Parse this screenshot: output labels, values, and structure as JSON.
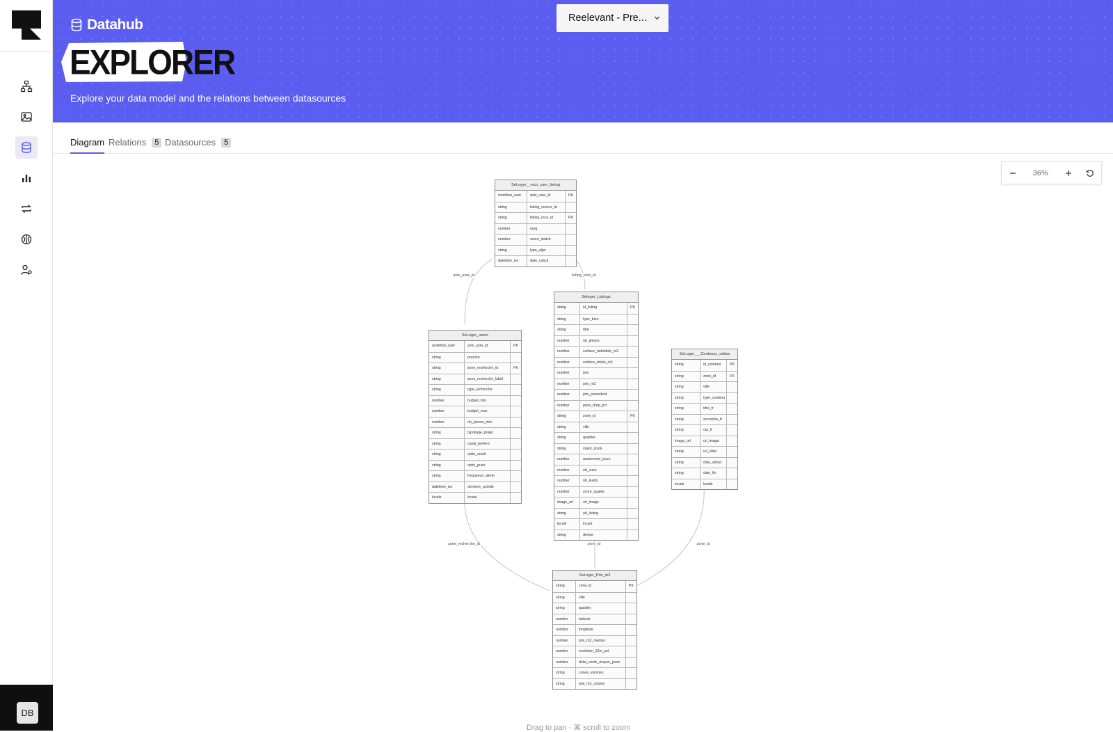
{
  "app": {
    "brand_label": "Datahub",
    "page_title": "EXPLORER",
    "subtitle": "Explore your data model and the relations between datasources",
    "project_selector": "Reelevant - Pre...",
    "avatar_initials": "DB",
    "accent_color": "#5b5cf0"
  },
  "sidebar": {
    "items": [
      {
        "icon": "workflow-icon",
        "active": false
      },
      {
        "icon": "image-gallery-icon",
        "active": false
      },
      {
        "icon": "database-icon",
        "active": true
      },
      {
        "icon": "bar-chart-icon",
        "active": false
      },
      {
        "icon": "sync-icon",
        "active": false
      },
      {
        "icon": "brain-icon",
        "active": false
      },
      {
        "icon": "users-settings-icon",
        "active": false
      }
    ]
  },
  "tabs": [
    {
      "label": "Diagram",
      "count": null
    },
    {
      "label": "Relations",
      "count": "5"
    },
    {
      "label": "Datasources",
      "count": "5"
    }
  ],
  "zoom": {
    "value": "36%"
  },
  "hint": "Drag to pan · ⌘ scroll to zoom",
  "tables": [
    {
      "name": "SeLoger__reco_user_listing",
      "rows": [
        [
          "workflow_user",
          "avtv_user_id",
          "PK"
        ],
        [
          "string",
          "listing_source_id",
          ""
        ],
        [
          "string",
          "listing_reco_id",
          "PK"
        ],
        [
          "number",
          "rang",
          ""
        ],
        [
          "number",
          "score_match",
          ""
        ],
        [
          "string",
          "type_algo",
          ""
        ],
        [
          "datetime_iso",
          "date_calcul",
          ""
        ]
      ]
    },
    {
      "name": "Seloger_Listings",
      "rows": [
        [
          "string",
          "id_listing",
          "PK"
        ],
        [
          "string",
          "type_bien",
          ""
        ],
        [
          "string",
          "titre",
          ""
        ],
        [
          "number",
          "nb_pieces",
          ""
        ],
        [
          "number",
          "surface_habitable_m2",
          ""
        ],
        [
          "number",
          "surface_totale_m2",
          ""
        ],
        [
          "number",
          "prix",
          ""
        ],
        [
          "number",
          "prix_m2",
          ""
        ],
        [
          "number",
          "prix_precedent",
          ""
        ],
        [
          "number",
          "price_drop_pct",
          ""
        ],
        [
          "string",
          "zone_id",
          "FK"
        ],
        [
          "string",
          "ville",
          ""
        ],
        [
          "string",
          "quartier",
          ""
        ],
        [
          "string",
          "statut_stock",
          ""
        ],
        [
          "number",
          "anciennete_jours",
          ""
        ],
        [
          "number",
          "nb_vues",
          ""
        ],
        [
          "number",
          "nb_leads",
          ""
        ],
        [
          "number",
          "score_qualite",
          ""
        ],
        [
          "image_url",
          "url_image",
          ""
        ],
        [
          "string",
          "url_listing",
          ""
        ],
        [
          "locale",
          "locale",
          ""
        ],
        [
          "string",
          "devise",
          ""
        ]
      ]
    },
    {
      "name": "SeLoger_users",
      "rows": [
        [
          "workflow_user",
          "avtv_user_id",
          "PK"
        ],
        [
          "string",
          "prenom",
          ""
        ],
        [
          "string",
          "zone_recherche_id",
          "FK"
        ],
        [
          "string",
          "zone_recherche_label",
          ""
        ],
        [
          "string",
          "type_recherche",
          ""
        ],
        [
          "number",
          "budget_min",
          ""
        ],
        [
          "number",
          "budget_max",
          ""
        ],
        [
          "number",
          "nb_pieces_min",
          ""
        ],
        [
          "string",
          "typologie_projet",
          ""
        ],
        [
          "string",
          "canal_prefere",
          ""
        ],
        [
          "string",
          "optin_email",
          ""
        ],
        [
          "string",
          "optin_push",
          ""
        ],
        [
          "string",
          "frequence_alerte",
          ""
        ],
        [
          "datetime_iso",
          "derniere_activite",
          ""
        ],
        [
          "locale",
          "locale",
          ""
        ]
      ]
    },
    {
      "name": "SeLoger___Contenus_editos",
      "rows": [
        [
          "string",
          "id_contenu",
          "PK"
        ],
        [
          "string",
          "zone_id",
          "FK"
        ],
        [
          "string",
          "ville",
          ""
        ],
        [
          "string",
          "type_contenu",
          ""
        ],
        [
          "string",
          "titre_fr",
          ""
        ],
        [
          "string",
          "accroche_fr",
          ""
        ],
        [
          "string",
          "cta_fr",
          ""
        ],
        [
          "image_url",
          "url_image",
          ""
        ],
        [
          "string",
          "url_cible",
          ""
        ],
        [
          "string",
          "date_debut",
          ""
        ],
        [
          "string",
          "date_fin",
          ""
        ],
        [
          "locale",
          "locale",
          ""
        ]
      ]
    },
    {
      "name": "SeLoger_Prix_m2",
      "rows": [
        [
          "string",
          "zone_id",
          "PK"
        ],
        [
          "string",
          "ville",
          ""
        ],
        [
          "string",
          "quartier",
          ""
        ],
        [
          "number",
          "latitude",
          ""
        ],
        [
          "number",
          "longitude",
          ""
        ],
        [
          "number",
          "prix_m2_median",
          ""
        ],
        [
          "number",
          "evolution_12m_pct",
          ""
        ],
        [
          "number",
          "delai_vente_moyen_jours",
          ""
        ],
        [
          "string",
          "zones_voisines",
          ""
        ],
        [
          "string",
          "prix_m2_voisins",
          ""
        ]
      ]
    }
  ],
  "relations": [
    {
      "label": "avtv_user_id"
    },
    {
      "label": "listing_reco_id"
    },
    {
      "label": "zone_recherche_id"
    },
    {
      "label": "zone_id"
    },
    {
      "label": "zone_id"
    }
  ]
}
